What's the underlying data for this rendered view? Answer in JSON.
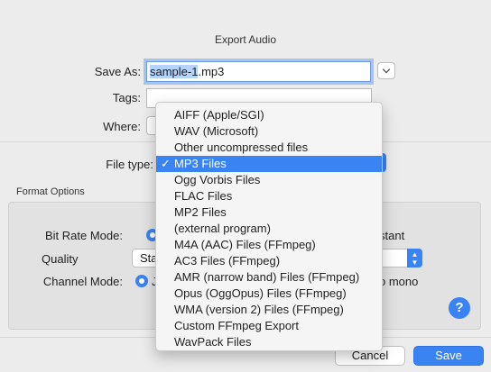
{
  "dialog": {
    "title": "Export Audio",
    "save_as_label": "Save As:",
    "filename": {
      "selected_part": "sample-1",
      "rest": ".mp3"
    },
    "tags_label": "Tags:",
    "tags_value": "",
    "where_label": "Where:",
    "file_type_label": "File type:",
    "format_options_label": "Format Options",
    "bit_rate_mode_label": "Bit Rate Mode:",
    "bit_rate_right_text": "stant",
    "quality_label": "Quality",
    "quality_value": "Sta",
    "channel_mode_label": "Channel Mode:",
    "channel_mode_partial": "J",
    "channel_right_text": "o mono",
    "help_icon_text": "?",
    "cancel_label": "Cancel",
    "save_label": "Save"
  },
  "file_type_menu": {
    "selected_index": 3,
    "check_mark": "✓",
    "items": [
      "AIFF (Apple/SGI)",
      "WAV (Microsoft)",
      "Other uncompressed files",
      "MP3 Files",
      "Ogg Vorbis Files",
      "FLAC Files",
      "MP2 Files",
      "(external program)",
      "M4A (AAC) Files (FFmpeg)",
      "AC3 Files (FFmpeg)",
      "AMR (narrow band) Files (FFmpeg)",
      "Opus (OggOpus) Files (FFmpeg)",
      "WMA (version 2) Files (FFmpeg)",
      "Custom FFmpeg Export",
      "WavPack Files"
    ]
  },
  "colors": {
    "accent": "#3a83f3",
    "selection": "#b5d4fd",
    "background": "#ececec"
  }
}
